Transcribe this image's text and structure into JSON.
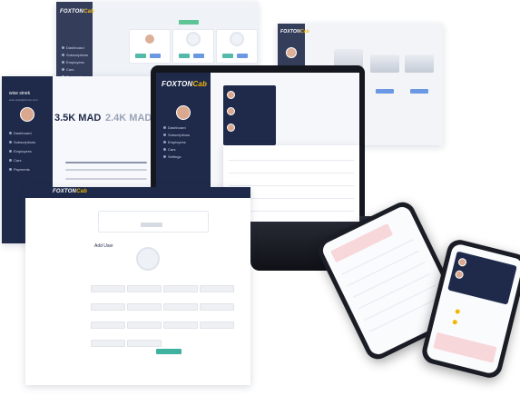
{
  "brand": {
    "name_part1": "FOXTON",
    "name_part2": "Cab"
  },
  "user": {
    "name": "wise sinek",
    "subtitle": "wise.sinek@foxton.com"
  },
  "nav": {
    "items": [
      "Dashboard",
      "Subscriptions",
      "Employees",
      "Cars",
      "Payments",
      "Settings"
    ]
  },
  "stats": {
    "value1": "3.5K MAD",
    "value2": "2.4K MAD"
  },
  "form": {
    "title": "Add User"
  },
  "colors": {
    "sidebar": "#1f2a4a",
    "accent": "#f2b705",
    "teal": "#3fb3a0",
    "blue": "#5b8de0"
  }
}
